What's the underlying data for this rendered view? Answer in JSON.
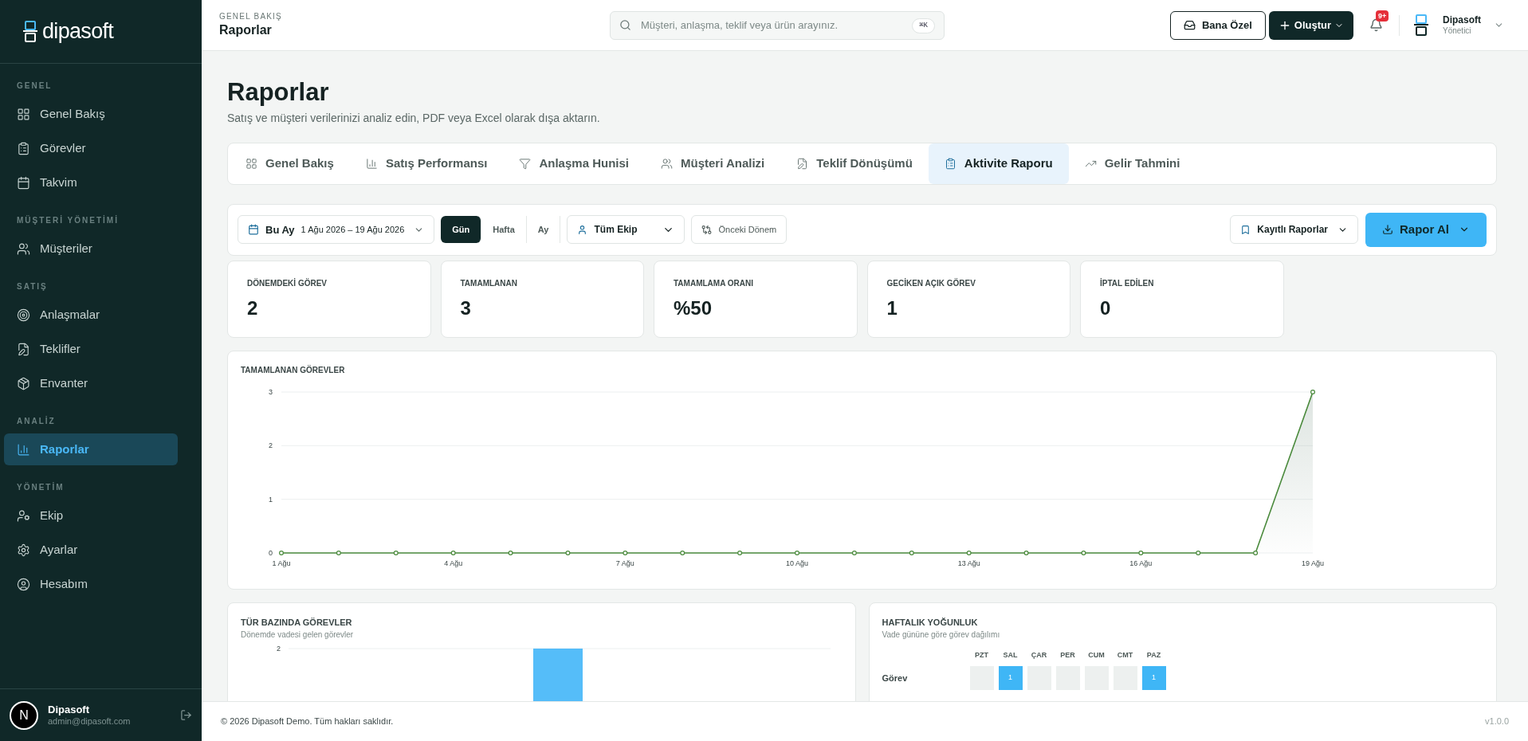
{
  "sidebar": {
    "logo_text": "dipasoft",
    "sections": [
      {
        "title": "GENEL",
        "items": [
          {
            "label": "Genel Bakış",
            "selected": false
          },
          {
            "label": "Görevler",
            "selected": false
          },
          {
            "label": "Takvim",
            "selected": false
          }
        ]
      },
      {
        "title": "MÜŞTERİ YÖNETİMİ",
        "items": [
          {
            "label": "Müşteriler",
            "selected": false
          }
        ]
      },
      {
        "title": "SATIŞ",
        "items": [
          {
            "label": "Anlaşmalar",
            "selected": false
          },
          {
            "label": "Teklifler",
            "selected": false
          },
          {
            "label": "Envanter",
            "selected": false
          }
        ]
      },
      {
        "title": "ANALİZ",
        "items": [
          {
            "label": "Raporlar",
            "selected": true
          }
        ]
      },
      {
        "title": "YÖNETİM",
        "items": [
          {
            "label": "Ekip",
            "selected": false
          },
          {
            "label": "Ayarlar",
            "selected": false
          },
          {
            "label": "Hesabım",
            "selected": false
          }
        ]
      }
    ],
    "user": {
      "avatar_letter": "N",
      "name": "Dipasoft",
      "email": "admin@dipasoft.com"
    }
  },
  "header": {
    "breadcrumb": "GENEL BAKIŞ",
    "title": "Raporlar",
    "search": {
      "placeholder": "Müşteri, anlaşma, teklif veya ürün arayınız.",
      "shortcut": "⌘K"
    },
    "buttons": {
      "mine": "Bana Özel",
      "create": "Oluştur"
    },
    "notification_badge": "9+",
    "user": {
      "name": "Dipasoft",
      "role": "Yönetici"
    }
  },
  "page": {
    "title": "Raporlar",
    "subtitle": "Satış ve müşteri verilerinizi analiz edin, PDF veya Excel olarak dışa aktarın."
  },
  "tabs": [
    {
      "label": "Genel Bakış",
      "selected": false
    },
    {
      "label": "Satış Performansı",
      "selected": false
    },
    {
      "label": "Anlaşma Hunisi",
      "selected": false
    },
    {
      "label": "Müşteri Analizi",
      "selected": false
    },
    {
      "label": "Teklif Dönüşümü",
      "selected": false
    },
    {
      "label": "Aktivite Raporu",
      "selected": true
    },
    {
      "label": "Gelir Tahmini",
      "selected": false
    }
  ],
  "filters": {
    "period": {
      "label": "Bu Ay",
      "range": "1 Ağu 2026 – 19 Ağu 2026"
    },
    "granularity": [
      {
        "label": "Gün",
        "selected": true
      },
      {
        "label": "Hafta",
        "selected": false
      },
      {
        "label": "Ay",
        "selected": false
      }
    ],
    "team": "Tüm Ekip",
    "compare": "Önceki Dönem",
    "saved_reports": "Kayıtlı Raporlar",
    "export": "Rapor Al"
  },
  "stats": [
    {
      "label": "DÖNEMDEKİ GÖREV",
      "value": "2"
    },
    {
      "label": "TAMAMLANAN",
      "value": "3"
    },
    {
      "label": "TAMAMLAMA ORANI",
      "value": "%50"
    },
    {
      "label": "GECİKEN AÇIK GÖREV",
      "value": "1"
    },
    {
      "label": "İPTAL EDİLEN",
      "value": "0"
    }
  ],
  "completed_chart": {
    "title": "TAMAMLANAN GÖREVLER",
    "chart_data": {
      "type": "area",
      "x": [
        1,
        2,
        3,
        4,
        5,
        6,
        7,
        8,
        9,
        10,
        11,
        12,
        13,
        14,
        15,
        16,
        17,
        18,
        19
      ],
      "series": [
        {
          "color": "#4a8a3c",
          "values": [
            0,
            0,
            0,
            0,
            0,
            0,
            0,
            0,
            0,
            0,
            0,
            0,
            0,
            0,
            0,
            0,
            0,
            0,
            3
          ]
        }
      ],
      "xticks": [
        {
          "value": 1,
          "label": "1 Ağu"
        },
        {
          "value": 4,
          "label": "4 Ağu"
        },
        {
          "value": 7,
          "label": "7 Ağu"
        },
        {
          "value": 10,
          "label": "10 Ağu"
        },
        {
          "value": 13,
          "label": "13 Ağu"
        },
        {
          "value": 16,
          "label": "16 Ağu"
        },
        {
          "value": 19,
          "label": "19 Ağu"
        }
      ],
      "xlim": [
        1,
        19
      ],
      "yticks": [
        0,
        1,
        2,
        3
      ],
      "ylim": [
        0,
        3
      ]
    }
  },
  "type_chart": {
    "title": "TÜR BAZINDA GÖREVLER",
    "subtitle": "Dönemde vadesi gelen görevler",
    "axis_label": "2"
  },
  "weekly": {
    "title": "HAFTALIK YOĞUNLUK",
    "subtitle": "Vade gününe göre görev dağılımı",
    "days": [
      "PZT",
      "SAL",
      "ÇAR",
      "PER",
      "CUM",
      "CMT",
      "PAZ"
    ],
    "rows": [
      {
        "label": "Görev",
        "cells": [
          {
            "active": false
          },
          {
            "active": true,
            "value": "1"
          },
          {
            "active": false
          },
          {
            "active": false
          },
          {
            "active": false
          },
          {
            "active": false
          },
          {
            "active": true,
            "value": "1"
          }
        ]
      }
    ]
  },
  "footer": {
    "copyright": "© 2026 Dipasoft Demo. Tüm hakları saklıdır.",
    "version": "v1.0.0"
  }
}
